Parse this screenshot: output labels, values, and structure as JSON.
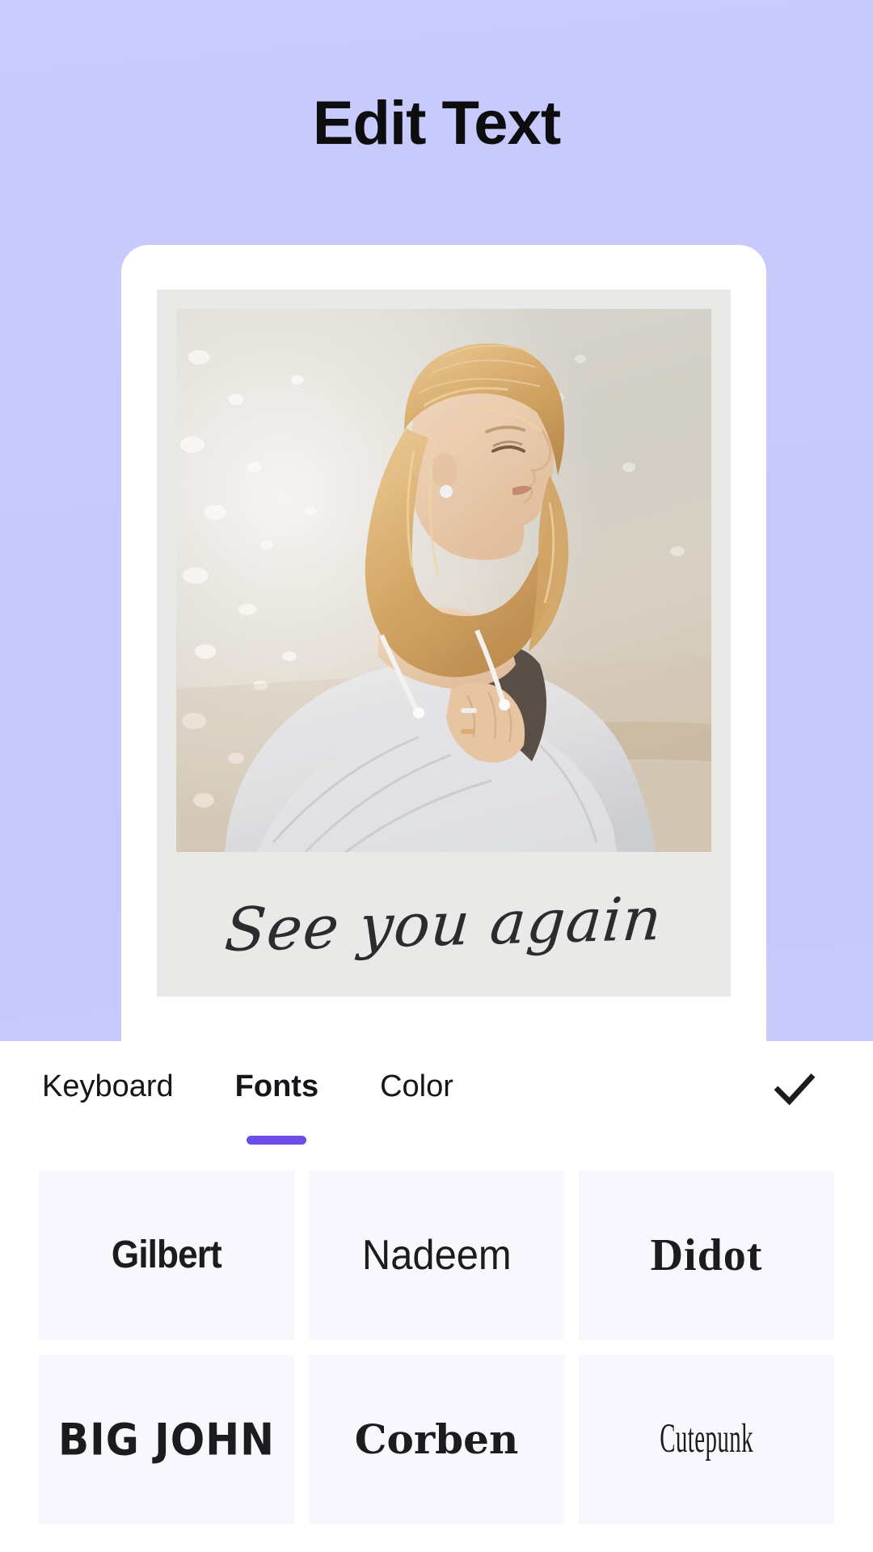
{
  "header": {
    "title": "Edit Text"
  },
  "preview": {
    "caption": "See you again",
    "photo_alt": "blonde-woman-beach-portrait"
  },
  "toolbar": {
    "tabs": [
      {
        "label": "Keyboard",
        "active": false
      },
      {
        "label": "Fonts",
        "active": true
      },
      {
        "label": "Color",
        "active": false
      }
    ],
    "confirm_icon": "check-icon"
  },
  "fonts": {
    "items": [
      {
        "label": "Gilbert"
      },
      {
        "label": "Nadeem"
      },
      {
        "label": "Didot"
      },
      {
        "label": "BIG JOHN"
      },
      {
        "label": "Corben"
      },
      {
        "label": "Cutepunk"
      }
    ]
  },
  "colors": {
    "background": "#c6c8fc",
    "accent": "#6c4de8",
    "card": "#ffffff",
    "polaroid": "#e9e9e7",
    "font_card": "#f7f7fd",
    "text": "#15151a"
  }
}
